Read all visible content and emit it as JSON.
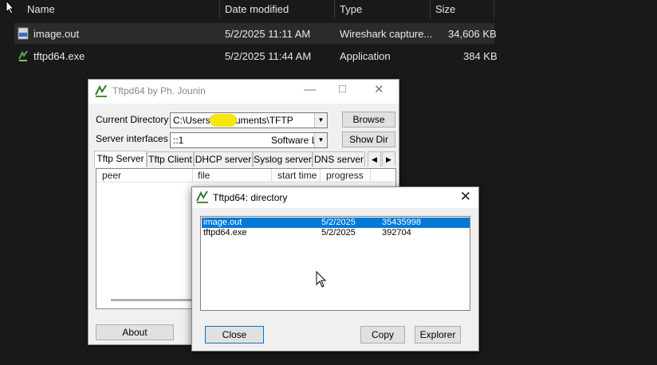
{
  "explorer": {
    "columns": {
      "name": "Name",
      "date": "Date modified",
      "type": "Type",
      "size": "Size"
    },
    "files": [
      {
        "name": "image.out",
        "date": "5/2/2025 11:11 AM",
        "type": "Wireshark capture...",
        "size": "34,606 KB"
      },
      {
        "name": "tftpd64.exe",
        "date": "5/2/2025 11:44 AM",
        "type": "Application",
        "size": "384 KB"
      }
    ]
  },
  "tftpd": {
    "title": "Tftpd64 by Ph. Jounin",
    "current_dir_label": "Current Directory",
    "current_dir_value": "C:\\Users\\ \\Documents\\TFTP",
    "server_if_label": "Server interfaces",
    "server_if_value": "::1",
    "server_if_extra": "Software L",
    "browse": "Browse",
    "showdir": "Show Dir",
    "tabs": [
      "Tftp Server",
      "Tftp Client",
      "DHCP server",
      "Syslog server",
      "DNS server"
    ],
    "table_cols": [
      "peer",
      "file",
      "start time",
      "progress"
    ],
    "about": "About"
  },
  "directory_dialog": {
    "title": "Tftpd64: directory",
    "rows": [
      {
        "name": "image.out",
        "date": "5/2/2025",
        "size": "35435998"
      },
      {
        "name": "tftpd64.exe",
        "date": "5/2/2025",
        "size": "392704"
      }
    ],
    "close": "Close",
    "copy": "Copy",
    "explorer": "Explorer"
  },
  "colors": {
    "selection": "#0078d7",
    "redaction": "#f5e60d",
    "explorer_bg": "#191919"
  }
}
